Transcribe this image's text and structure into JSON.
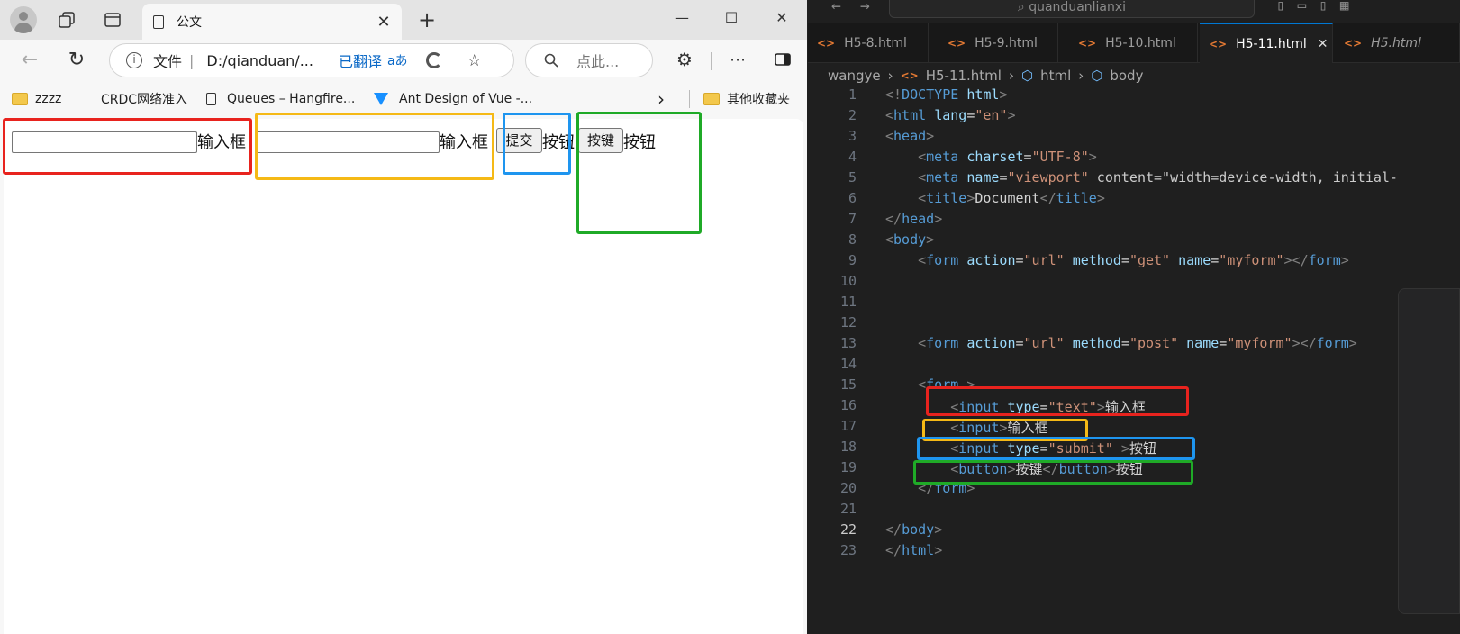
{
  "browser": {
    "tab_title": "公文",
    "tab_close": "✕",
    "new_tab": "+",
    "window_controls": {
      "minimize": "—",
      "maximize": "☐",
      "close": "✕"
    },
    "nav": {
      "back": "←",
      "reload": "↻"
    },
    "address": {
      "label": "文件",
      "separator": "|",
      "url": "D:/qianduan/...",
      "translated": "已翻译",
      "translate_icon": "aあ"
    },
    "search_placeholder": "点此...",
    "bookmarks": [
      "zzzz",
      "CRDC网络准入",
      "Queues – Hangfire...",
      "Ant Design of Vue -..."
    ],
    "bookmarks_more": "›",
    "other_bookmarks": "其他收藏夹"
  },
  "page": {
    "input1_label": "输入框",
    "input2_label": "输入框",
    "submit_value": "提交",
    "submit_label": "按钮",
    "button_text": "按键",
    "button_label": "按钮"
  },
  "highlight_colors": {
    "red": "#e8231e",
    "yellow": "#f5b916",
    "blue": "#1e95ef",
    "green": "#1faa27"
  },
  "editor": {
    "search": "quanduanlianxi",
    "tabs": [
      "H5-8.html",
      "H5-9.html",
      "H5-10.html",
      "H5-11.html",
      "H5.html"
    ],
    "active_tab": "H5-11.html",
    "tab_close": "✕",
    "breadcrumb": [
      "wangye",
      "H5-11.html",
      "html",
      "body"
    ],
    "line_numbers": [
      "1",
      "2",
      "3",
      "4",
      "5",
      "6",
      "7",
      "8",
      "9",
      "10",
      "11",
      "12",
      "13",
      "14",
      "15",
      "16",
      "17",
      "18",
      "19",
      "20",
      "21",
      "22",
      "23"
    ],
    "lines": [
      "<!DOCTYPE html>",
      "<html lang=\"en\">",
      "<head>",
      "    <meta charset=\"UTF-8\">",
      "    <meta name=\"viewport\" content=\"width=device-width, initial-",
      "    <title>Document</title>",
      "</head>",
      "<body>",
      "    <form action=\"url\" method=\"get\" name=\"myform\"></form>",
      "",
      "",
      "",
      "    <form action=\"url\" method=\"post\" name=\"myform\"></form>",
      "",
      "    <form >",
      "        <input type=\"text\">输入框",
      "        <input>输入框",
      "        <input type=\"submit\" >按钮",
      "        <button>按键</button>按钮",
      "    </form>",
      "",
      "</body>",
      "</html>"
    ]
  }
}
